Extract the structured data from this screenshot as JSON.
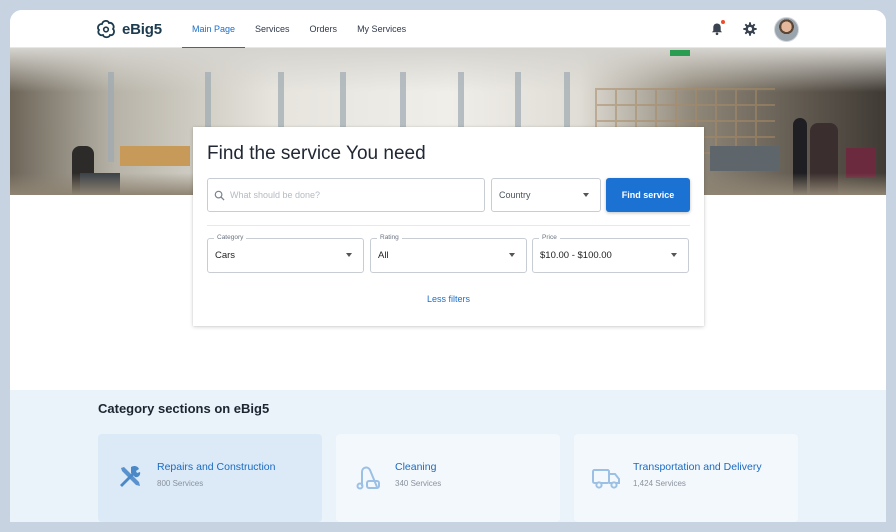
{
  "app": {
    "logo_text": "eBig5"
  },
  "nav": {
    "items": [
      {
        "label": "Main Page",
        "active": true
      },
      {
        "label": "Services",
        "active": false
      },
      {
        "label": "Orders",
        "active": false
      },
      {
        "label": "My Services",
        "active": false
      }
    ]
  },
  "header_icons": {
    "notification": "bell-icon",
    "settings": "gear-icon",
    "profile": "avatar"
  },
  "colors": {
    "accent": "#1b72d3",
    "link": "#1b6fc9",
    "notification_dot": "#f04b2a",
    "section_bg": "#eaf2fa"
  },
  "search": {
    "title": "Find the service You need",
    "placeholder": "What should be done?",
    "country_placeholder": "Country",
    "button": "Find service",
    "filters": {
      "category": {
        "label": "Category",
        "value": "Cars"
      },
      "rating": {
        "label": "Rating",
        "value": "All"
      },
      "price": {
        "label": "Price",
        "value": "$10.00 - $100.00"
      }
    },
    "less_filters": "Less filters"
  },
  "categories": {
    "heading": "Category sections on eBig5",
    "items": [
      {
        "name": "Repairs and Construction",
        "count": "800 Services",
        "icon": "tools-icon"
      },
      {
        "name": "Cleaning",
        "count": "340 Services",
        "icon": "vacuum-icon"
      },
      {
        "name": "Transportation and Delivery",
        "count": "1,424 Services",
        "icon": "truck-icon"
      }
    ]
  }
}
